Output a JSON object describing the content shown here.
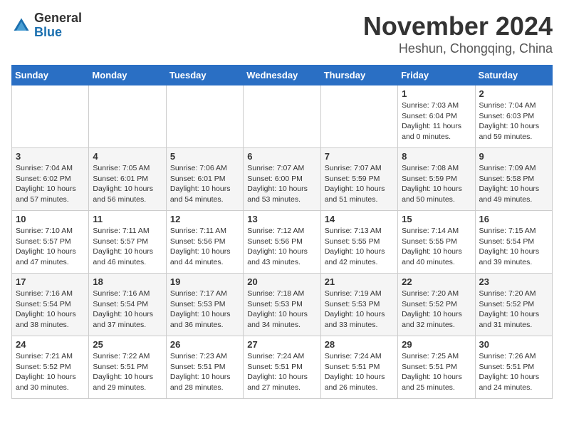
{
  "header": {
    "logo_general": "General",
    "logo_blue": "Blue",
    "title": "November 2024",
    "subtitle": "Heshun, Chongqing, China"
  },
  "weekdays": [
    "Sunday",
    "Monday",
    "Tuesday",
    "Wednesday",
    "Thursday",
    "Friday",
    "Saturday"
  ],
  "weeks": [
    [
      {
        "day": "",
        "info": ""
      },
      {
        "day": "",
        "info": ""
      },
      {
        "day": "",
        "info": ""
      },
      {
        "day": "",
        "info": ""
      },
      {
        "day": "",
        "info": ""
      },
      {
        "day": "1",
        "info": "Sunrise: 7:03 AM\nSunset: 6:04 PM\nDaylight: 11 hours and 0 minutes."
      },
      {
        "day": "2",
        "info": "Sunrise: 7:04 AM\nSunset: 6:03 PM\nDaylight: 10 hours and 59 minutes."
      }
    ],
    [
      {
        "day": "3",
        "info": "Sunrise: 7:04 AM\nSunset: 6:02 PM\nDaylight: 10 hours and 57 minutes."
      },
      {
        "day": "4",
        "info": "Sunrise: 7:05 AM\nSunset: 6:01 PM\nDaylight: 10 hours and 56 minutes."
      },
      {
        "day": "5",
        "info": "Sunrise: 7:06 AM\nSunset: 6:01 PM\nDaylight: 10 hours and 54 minutes."
      },
      {
        "day": "6",
        "info": "Sunrise: 7:07 AM\nSunset: 6:00 PM\nDaylight: 10 hours and 53 minutes."
      },
      {
        "day": "7",
        "info": "Sunrise: 7:07 AM\nSunset: 5:59 PM\nDaylight: 10 hours and 51 minutes."
      },
      {
        "day": "8",
        "info": "Sunrise: 7:08 AM\nSunset: 5:59 PM\nDaylight: 10 hours and 50 minutes."
      },
      {
        "day": "9",
        "info": "Sunrise: 7:09 AM\nSunset: 5:58 PM\nDaylight: 10 hours and 49 minutes."
      }
    ],
    [
      {
        "day": "10",
        "info": "Sunrise: 7:10 AM\nSunset: 5:57 PM\nDaylight: 10 hours and 47 minutes."
      },
      {
        "day": "11",
        "info": "Sunrise: 7:11 AM\nSunset: 5:57 PM\nDaylight: 10 hours and 46 minutes."
      },
      {
        "day": "12",
        "info": "Sunrise: 7:11 AM\nSunset: 5:56 PM\nDaylight: 10 hours and 44 minutes."
      },
      {
        "day": "13",
        "info": "Sunrise: 7:12 AM\nSunset: 5:56 PM\nDaylight: 10 hours and 43 minutes."
      },
      {
        "day": "14",
        "info": "Sunrise: 7:13 AM\nSunset: 5:55 PM\nDaylight: 10 hours and 42 minutes."
      },
      {
        "day": "15",
        "info": "Sunrise: 7:14 AM\nSunset: 5:55 PM\nDaylight: 10 hours and 40 minutes."
      },
      {
        "day": "16",
        "info": "Sunrise: 7:15 AM\nSunset: 5:54 PM\nDaylight: 10 hours and 39 minutes."
      }
    ],
    [
      {
        "day": "17",
        "info": "Sunrise: 7:16 AM\nSunset: 5:54 PM\nDaylight: 10 hours and 38 minutes."
      },
      {
        "day": "18",
        "info": "Sunrise: 7:16 AM\nSunset: 5:54 PM\nDaylight: 10 hours and 37 minutes."
      },
      {
        "day": "19",
        "info": "Sunrise: 7:17 AM\nSunset: 5:53 PM\nDaylight: 10 hours and 36 minutes."
      },
      {
        "day": "20",
        "info": "Sunrise: 7:18 AM\nSunset: 5:53 PM\nDaylight: 10 hours and 34 minutes."
      },
      {
        "day": "21",
        "info": "Sunrise: 7:19 AM\nSunset: 5:53 PM\nDaylight: 10 hours and 33 minutes."
      },
      {
        "day": "22",
        "info": "Sunrise: 7:20 AM\nSunset: 5:52 PM\nDaylight: 10 hours and 32 minutes."
      },
      {
        "day": "23",
        "info": "Sunrise: 7:20 AM\nSunset: 5:52 PM\nDaylight: 10 hours and 31 minutes."
      }
    ],
    [
      {
        "day": "24",
        "info": "Sunrise: 7:21 AM\nSunset: 5:52 PM\nDaylight: 10 hours and 30 minutes."
      },
      {
        "day": "25",
        "info": "Sunrise: 7:22 AM\nSunset: 5:51 PM\nDaylight: 10 hours and 29 minutes."
      },
      {
        "day": "26",
        "info": "Sunrise: 7:23 AM\nSunset: 5:51 PM\nDaylight: 10 hours and 28 minutes."
      },
      {
        "day": "27",
        "info": "Sunrise: 7:24 AM\nSunset: 5:51 PM\nDaylight: 10 hours and 27 minutes."
      },
      {
        "day": "28",
        "info": "Sunrise: 7:24 AM\nSunset: 5:51 PM\nDaylight: 10 hours and 26 minutes."
      },
      {
        "day": "29",
        "info": "Sunrise: 7:25 AM\nSunset: 5:51 PM\nDaylight: 10 hours and 25 minutes."
      },
      {
        "day": "30",
        "info": "Sunrise: 7:26 AM\nSunset: 5:51 PM\nDaylight: 10 hours and 24 minutes."
      }
    ]
  ]
}
